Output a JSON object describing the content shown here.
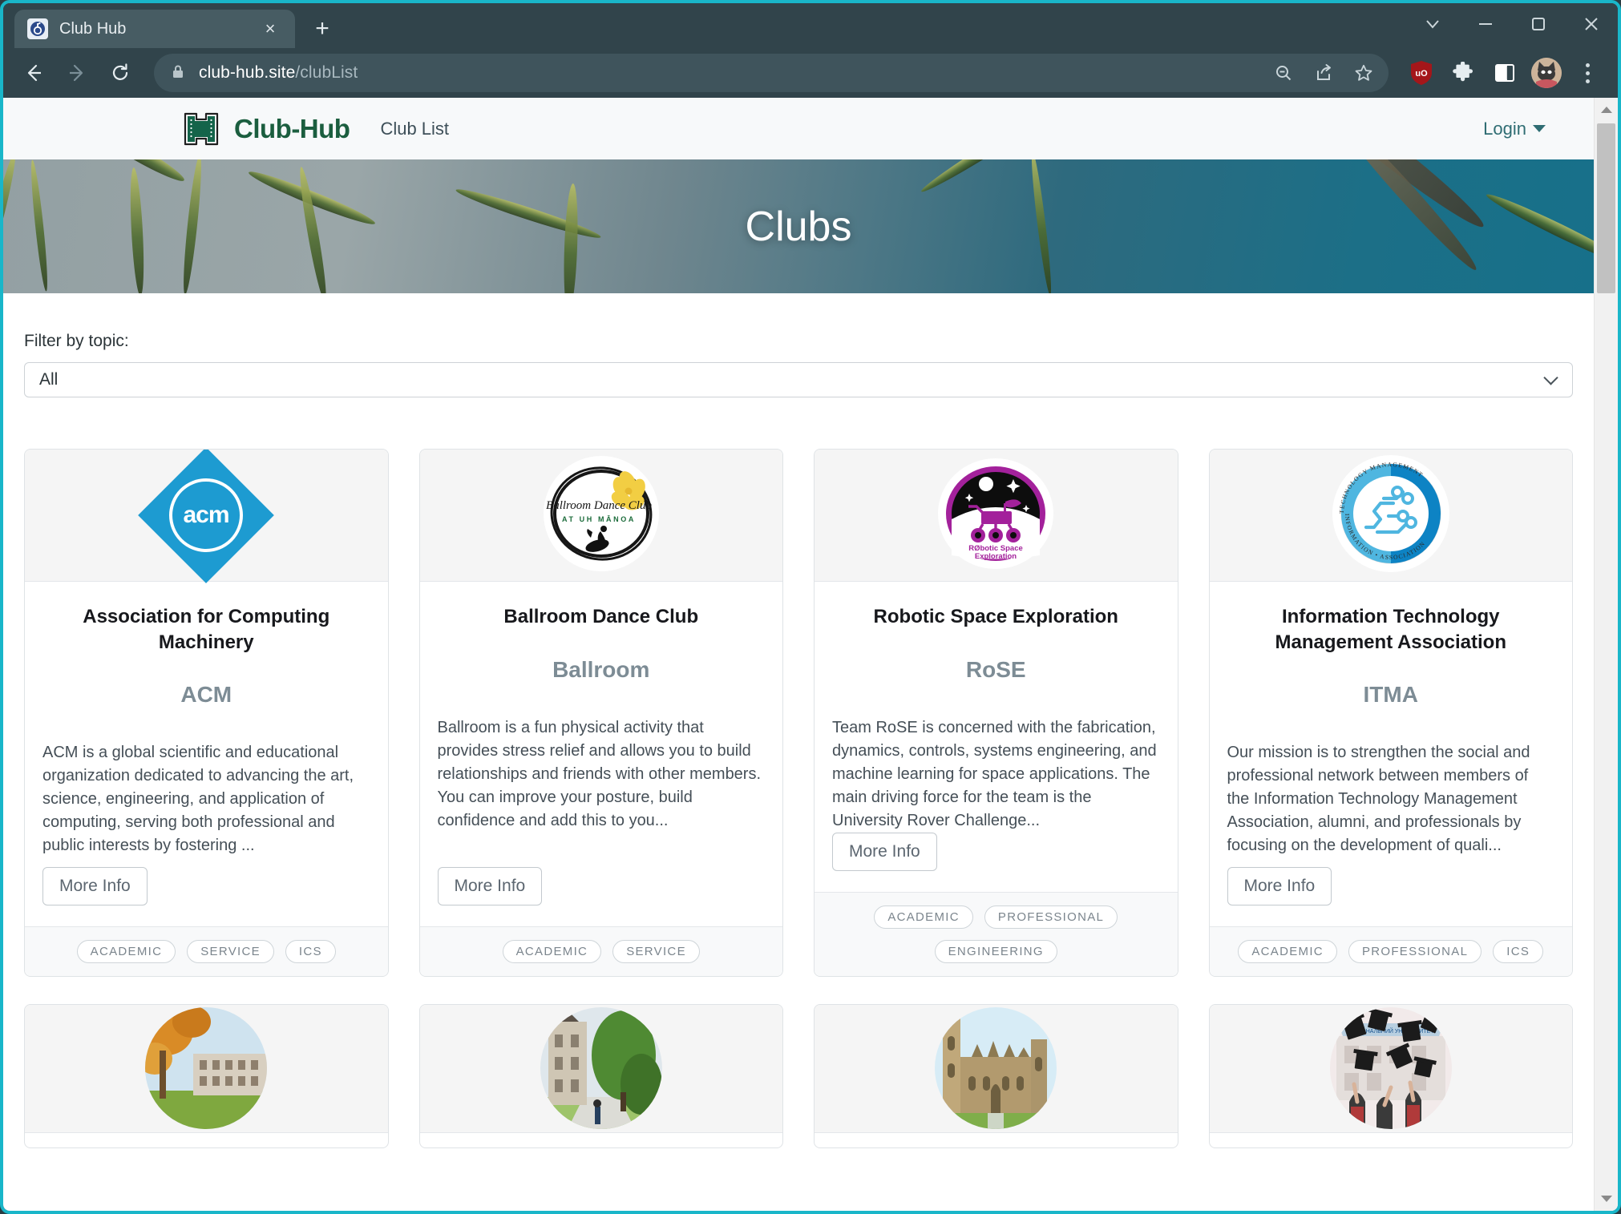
{
  "browser": {
    "tab": {
      "title": "Club Hub",
      "favicon_icon": "club-hub-favicon"
    },
    "new_tab_label": "+",
    "close_tab_label": "×",
    "window_controls": {
      "tab_search_icon": "chevron-down-icon",
      "minimize_icon": "minimize-icon",
      "maximize_icon": "maximize-icon",
      "close_icon": "close-icon"
    },
    "toolbar": {
      "back_icon": "back-arrow-icon",
      "forward_icon": "forward-arrow-icon",
      "reload_icon": "reload-icon",
      "lock_icon": "lock-icon",
      "url_domain": "club-hub.site",
      "url_path": "/clubList",
      "zoom_out_icon": "zoom-out-icon",
      "share_icon": "share-icon",
      "bookmark_icon": "star-icon",
      "ublock_icon": "ublock-origin-icon",
      "ublock_label": "uO",
      "extensions_icon": "puzzle-piece-icon",
      "side_panel_icon": "side-panel-icon",
      "profile_icon": "profile-avatar-icon",
      "menu_icon": "kebab-menu-icon"
    }
  },
  "site": {
    "brand_name": "Club-Hub",
    "brand_logo_icon": "uh-manoa-h-logo",
    "nav_links": [
      {
        "label": "Club List"
      }
    ],
    "login": {
      "label": "Login",
      "caret_icon": "caret-down-icon"
    }
  },
  "hero": {
    "title": "Clubs",
    "image_icon": "palm-trees-photo"
  },
  "filter": {
    "label": "Filter by topic:",
    "selected": "All",
    "chevron_icon": "chevron-down-icon"
  },
  "cards": [
    {
      "logo_icon": "acm-logo",
      "title": "Association for Computing Machinery",
      "abbr": "ACM",
      "description": "ACM is a global scientific and educational organization dedicated to advancing the art, science, engineering, and application of computing, serving both professional and public interests by fostering ...",
      "button": "More Info",
      "tags": [
        "ACADEMIC",
        "SERVICE",
        "ICS"
      ]
    },
    {
      "logo_icon": "ballroom-dance-club-logo",
      "title": "Ballroom Dance Club",
      "abbr": "Ballroom",
      "description": "Ballroom is a fun physical activity that provides stress relief and allows you to build relationships and friends with other members. You can improve your posture, build confidence and add this to you...",
      "button": "More Info",
      "tags": [
        "ACADEMIC",
        "SERVICE"
      ]
    },
    {
      "logo_icon": "robotic-space-exploration-logo",
      "title": "Robotic Space Exploration",
      "abbr": "RoSE",
      "description": "Team RoSE is concerned with the fabrication, dynamics, controls, systems engineering, and machine learning for space applications. The main driving force for the team is the University Rover Challenge...",
      "button": "More Info",
      "tags": [
        "ACADEMIC",
        "PROFESSIONAL",
        "ENGINEERING"
      ]
    },
    {
      "logo_icon": "itma-logo",
      "title": "Information Technology Management Association",
      "abbr": "ITMA",
      "description": "Our mission is to strengthen the social and professional network between members of the Information Technology Management Association, alumni, and professionals by focusing on the development of quali...",
      "button": "More Info",
      "tags": [
        "ACADEMIC",
        "PROFESSIONAL",
        "ICS"
      ]
    }
  ],
  "cards_row2": [
    {
      "logo_icon": "autumn-campus-photo"
    },
    {
      "logo_icon": "campus-pathway-photo"
    },
    {
      "logo_icon": "gothic-university-photo"
    },
    {
      "logo_icon": "graduation-caps-photo"
    }
  ],
  "colors": {
    "brand_green": "#1b5e3f",
    "login_teal": "#2f6d73",
    "window_border": "#19b6c9",
    "chrome": "#31444b",
    "card_border": "#dfe3e6",
    "pill_text": "#7b858d"
  }
}
